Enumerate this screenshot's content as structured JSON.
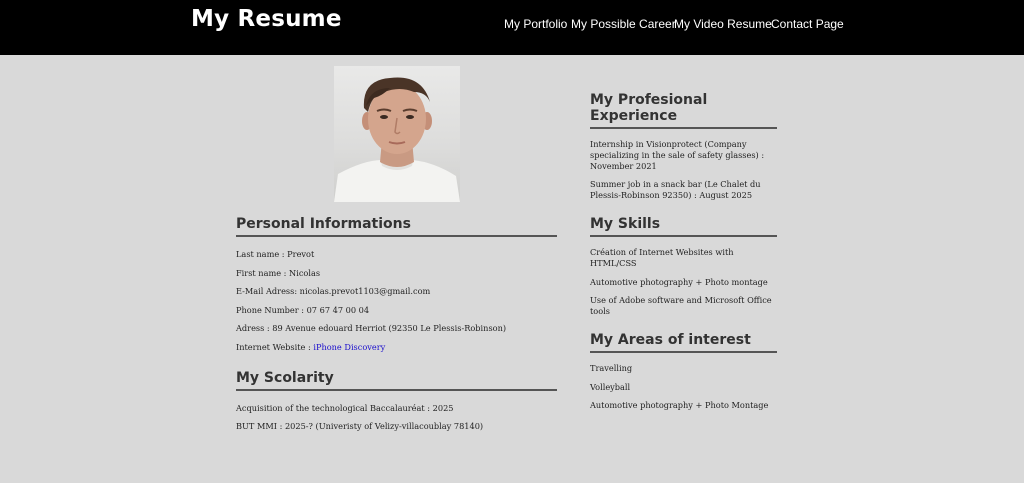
{
  "header": {
    "brand": "My Resume",
    "nav": [
      "My Portfolio",
      "My Possible Career",
      "My Video Resume",
      "Contact Page"
    ]
  },
  "personal": {
    "title": "Personal Informations",
    "items": [
      "Last name : Prevot",
      "First name : Nicolas",
      "E-Mail Adress: nicolas.prevot1103@gmail.com",
      "Phone Number : 07 67 47 00 04",
      "Adress : 89 Avenue edouard Herriot (92350 Le Plessis-Robinson)"
    ],
    "website_label": "Internet Website : ",
    "website_link": "iPhone Discovery"
  },
  "scolarity": {
    "title": "My Scolarity",
    "items": [
      "Acquisition of the technological Baccalauréat : 2025",
      "BUT MMI : 2025-? (Univeristy of Velizy-villacoublay 78140)"
    ]
  },
  "experience": {
    "title": "My Profesional Experience",
    "items": [
      "Internship in Visionprotect (Company specializing in the sale of safety glasses) : November 2021",
      "Summer job in a snack bar (Le Chalet du Plessis-Robinson 92350) : August 2025"
    ]
  },
  "skills": {
    "title": "My Skills",
    "items": [
      "Création of Internet Websites with HTML/CSS",
      "Automotive photography + Photo montage",
      "Use of Adobe software and Microsoft Office tools"
    ]
  },
  "interests": {
    "title": "My Areas of interest",
    "items": [
      "Travelling",
      "Volleyball",
      "Automotive photography + Photo Montage"
    ]
  },
  "colors": {
    "header_bg": "#000000",
    "page_bg": "#d9d9d9",
    "link": "#1a0dcc"
  }
}
